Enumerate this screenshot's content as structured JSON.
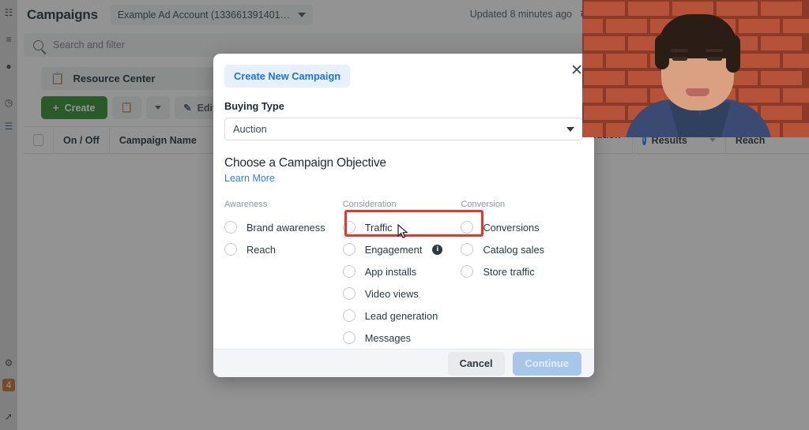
{
  "browser": {
    "extension_icons": [
      "puzzle-icon",
      "list-icon",
      "avatar-icon",
      "clock-icon",
      "bookmark-icon",
      "gear-icon",
      "badge-icon",
      "cursor-icon"
    ]
  },
  "app": {
    "page_title": "Campaigns",
    "account_selector": {
      "value": "Example Ad Account (133661391401…",
      "icon": "chevron-down-icon"
    },
    "updated_status": "Updated 8 minutes ago",
    "refresh_icon": "refresh-icon",
    "search": {
      "placeholder": "Search and filter",
      "icon": "search-icon"
    },
    "resource_center": {
      "label": "Resource Center",
      "icon": "clipboard-icon"
    },
    "toolbar": {
      "create_label": "Create",
      "create_plus": "+",
      "duplicate_icon": "duplicate-icon",
      "duplicate_caret": "chevron-down-icon",
      "edit_label": "Edit",
      "edit_icon": "pencil-icon",
      "edit_caret": "chevron-down-icon"
    },
    "table": {
      "columns": [
        {
          "label": "",
          "type": "checkbox"
        },
        {
          "label": "On / Off",
          "type": "text"
        },
        {
          "label": "Campaign Name",
          "type": "text"
        },
        {
          "label": "ttribution\nng",
          "type": "text"
        },
        {
          "label": "Results",
          "type": "info"
        },
        {
          "label": "Reach",
          "type": "text"
        }
      ]
    }
  },
  "modal": {
    "tab_label": "Create New Campaign",
    "close_icon": "close-icon",
    "buying_type": {
      "label": "Buying Type",
      "value": "Auction",
      "caret": "chevron-down-icon"
    },
    "objective": {
      "title": "Choose a Campaign Objective",
      "learn_more": "Learn More",
      "columns": [
        {
          "heading": "Awareness",
          "options": [
            {
              "label": "Brand awareness",
              "selected": false,
              "info": false
            },
            {
              "label": "Reach",
              "selected": false,
              "info": false
            }
          ]
        },
        {
          "heading": "Consideration",
          "options": [
            {
              "label": "Traffic",
              "selected": false,
              "info": false
            },
            {
              "label": "Engagement",
              "selected": false,
              "info": true
            },
            {
              "label": "App installs",
              "selected": false,
              "info": false
            },
            {
              "label": "Video views",
              "selected": false,
              "info": false
            },
            {
              "label": "Lead generation",
              "selected": false,
              "info": false
            },
            {
              "label": "Messages",
              "selected": false,
              "info": false
            }
          ]
        },
        {
          "heading": "Conversion",
          "options": [
            {
              "label": "Conversions",
              "selected": false,
              "info": false
            },
            {
              "label": "Catalog sales",
              "selected": false,
              "info": false
            },
            {
              "label": "Store traffic",
              "selected": false,
              "info": false
            }
          ]
        }
      ]
    },
    "footer": {
      "cancel_label": "Cancel",
      "continue_label": "Continue"
    }
  },
  "annotation": {
    "highlight_color": "#e8342a",
    "highlight_target": "Engagement"
  },
  "webcam": {
    "present": true,
    "description": "presenter-video-overlay"
  }
}
